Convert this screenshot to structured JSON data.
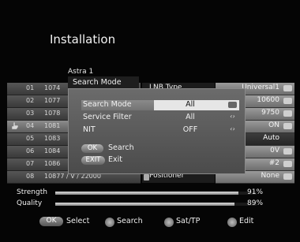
{
  "title": "Installation",
  "satellite": "Astra 1",
  "channels": [
    {
      "num": "01",
      "freq": "1074"
    },
    {
      "num": "02",
      "freq": "1077"
    },
    {
      "num": "03",
      "freq": "1078"
    },
    {
      "num": "04",
      "freq": "1081"
    },
    {
      "num": "05",
      "freq": "1083"
    },
    {
      "num": "06",
      "freq": "1084"
    },
    {
      "num": "07",
      "freq": "1086"
    },
    {
      "num": "08",
      "freq": "10877 / V / 22000"
    }
  ],
  "params": {
    "lnb_type_label": "LNB Type",
    "lnb_type_value": "Universal1",
    "row2_value": "10600",
    "row3_value": "9750",
    "row4_value": "ON",
    "row5_value": "Auto",
    "row6_value": "0V",
    "row7_value": "#2",
    "positioner_label": "Positioner",
    "positioner_value": "None"
  },
  "signal": {
    "strength_label": "Strength",
    "strength_value": "91%",
    "strength_fraction": 0.91,
    "quality_label": "Quality",
    "quality_value": "89%",
    "quality_fraction": 0.89
  },
  "dialog": {
    "title": "Search Mode",
    "rows": [
      {
        "label": "Search Mode",
        "value": "All"
      },
      {
        "label": "Service Filter",
        "value": "All"
      },
      {
        "label": "NIT",
        "value": "OFF"
      }
    ],
    "arrow_glyph": "‹›",
    "ok_badge": "OK",
    "ok_action": "Search",
    "exit_badge": "EXIT",
    "exit_action": "Exit"
  },
  "footer": {
    "ok_badge": "OK",
    "select": "Select",
    "search": "Search",
    "sattp": "Sat/TP",
    "edit": "Edit"
  },
  "colors": {
    "background": "#050505",
    "highlight": "#e6e6e6",
    "panel": "#6b6b6b"
  }
}
